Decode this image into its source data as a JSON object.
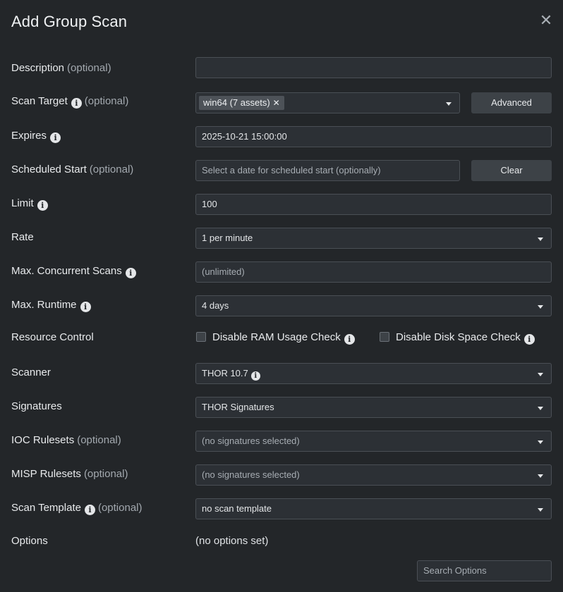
{
  "dialog": {
    "title": "Add Group Scan",
    "close_glyph": "✕"
  },
  "labels": {
    "description": "Description",
    "scan_target": "Scan Target",
    "expires": "Expires",
    "scheduled_start": "Scheduled Start",
    "limit": "Limit",
    "rate": "Rate",
    "max_concurrent": "Max. Concurrent Scans",
    "max_runtime": "Max. Runtime",
    "resource_control": "Resource Control",
    "scanner": "Scanner",
    "signatures": "Signatures",
    "ioc_rulesets": "IOC Rulesets",
    "misp_rulesets": "MISP Rulesets",
    "scan_template": "Scan Template",
    "options": "Options",
    "optional": "(optional)"
  },
  "fields": {
    "description_value": "",
    "scan_target_tag": "win64 (7 assets)",
    "scan_target_tag_remove": "✕",
    "advanced_button": "Advanced",
    "expires_value": "2025-10-21 15:00:00",
    "scheduled_start_placeholder": "Select a date for scheduled start (optionally)",
    "clear_button": "Clear",
    "limit_value": "100",
    "rate_value": "1 per minute",
    "max_concurrent_placeholder": "(unlimited)",
    "max_runtime_value": "4 days",
    "disable_ram_label": "Disable RAM Usage Check",
    "disable_disk_label": "Disable Disk Space Check",
    "scanner_value": "THOR 10.7",
    "signatures_value": "THOR Signatures",
    "ioc_rulesets_value": "(no signatures selected)",
    "misp_rulesets_value": "(no signatures selected)",
    "scan_template_value": "no scan template",
    "options_value": "(no options set)",
    "search_options_placeholder": "Search Options"
  },
  "icons": {
    "info": "i",
    "dropdown": "caret-down-icon"
  },
  "checkboxes": {
    "disable_ram_checked": false,
    "disable_disk_checked": false
  },
  "colors": {
    "background": "#232629",
    "field_bg": "#2c3035",
    "field_border": "#4a4f55",
    "button_bg": "#3d4247",
    "tag_bg": "#4d5258",
    "text": "#e4e6e8",
    "muted": "#a3a9af"
  }
}
